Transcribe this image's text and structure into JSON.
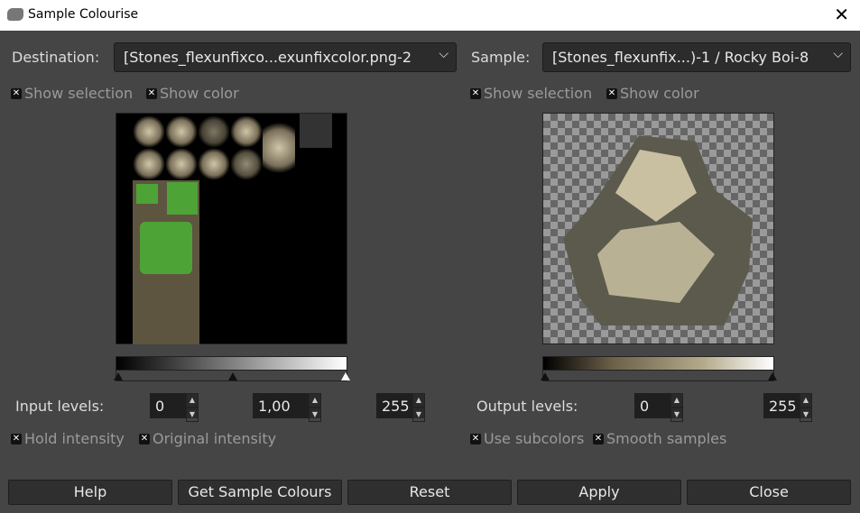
{
  "window": {
    "title": "Sample Colourise",
    "close_icon": "close-icon"
  },
  "destination": {
    "label": "Destination:",
    "value": "[Stones_flexunfixco...exunfixcolor.png-2",
    "show_selection": "Show selection",
    "show_color": "Show color"
  },
  "sample": {
    "label": "Sample:",
    "value": "[Stones_flexunfix...)-1 / Rocky Boi-8",
    "show_selection": "Show selection",
    "show_color": "Show color"
  },
  "input_levels": {
    "label": "Input levels:",
    "low": "0",
    "gamma": "1,00",
    "high": "255"
  },
  "output_levels": {
    "label": "Output levels:",
    "low": "0",
    "high": "255"
  },
  "options": {
    "hold_intensity": "Hold intensity",
    "original_intensity": "Original intensity",
    "use_subcolors": "Use subcolors",
    "smooth_samples": "Smooth samples"
  },
  "buttons": {
    "help": "Help",
    "get_sample": "Get Sample Colours",
    "reset": "Reset",
    "apply": "Apply",
    "close": "Close"
  }
}
